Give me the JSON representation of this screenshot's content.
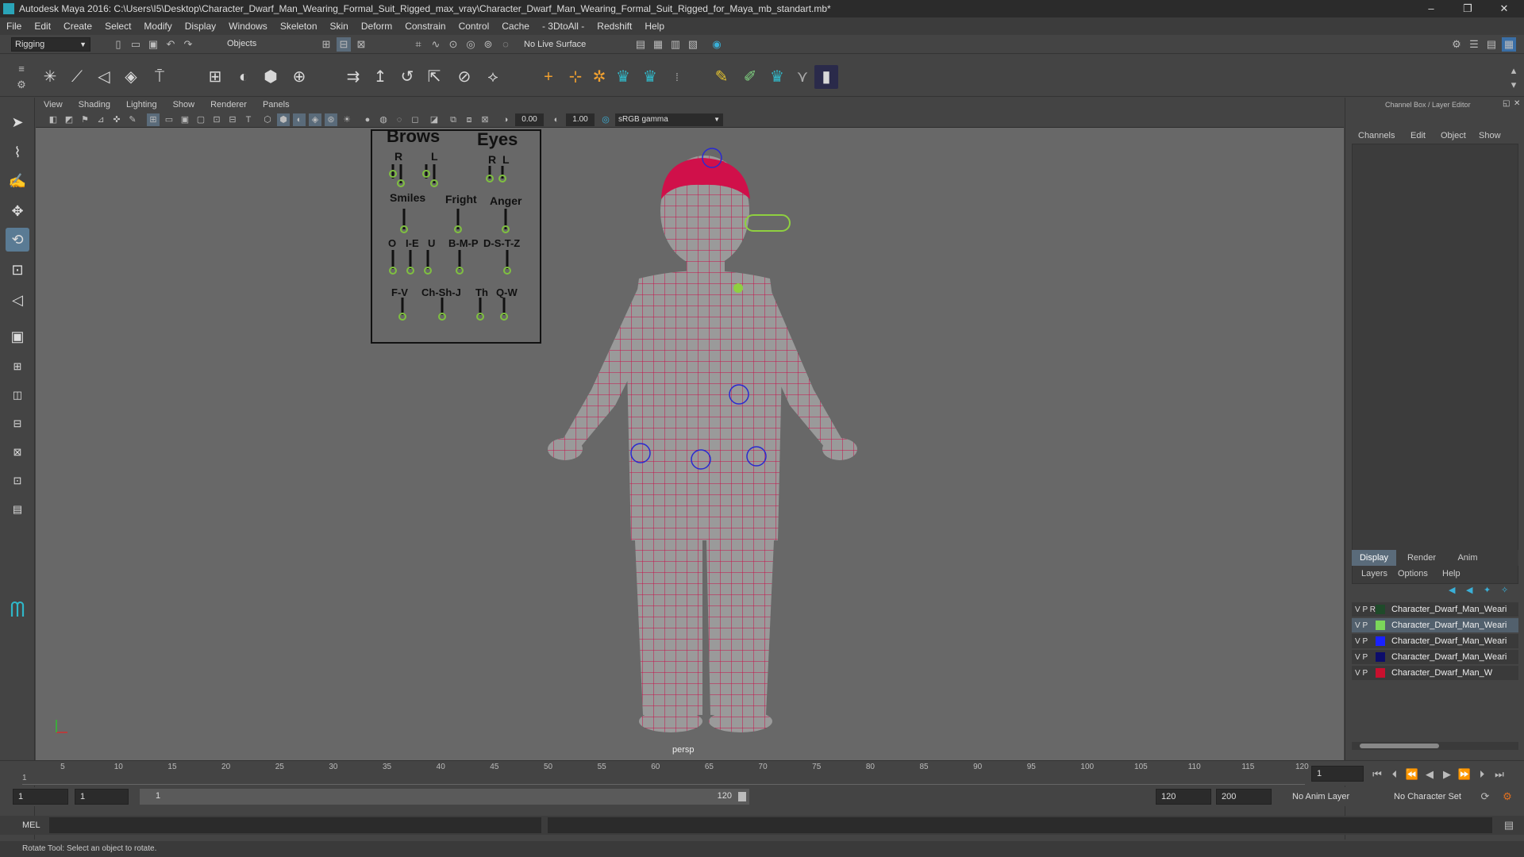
{
  "window": {
    "title": "Autodesk Maya 2016: C:\\Users\\I5\\Desktop\\Character_Dwarf_Man_Wearing_Formal_Suit_Rigged_max_vray\\Character_Dwarf_Man_Wearing_Formal_Suit_Rigged_for_Maya_mb_standart.mb*",
    "minimize": "–",
    "maximize": "❐",
    "close": "✕"
  },
  "menu": [
    "File",
    "Edit",
    "Create",
    "Select",
    "Modify",
    "Display",
    "Windows",
    "Skeleton",
    "Skin",
    "Deform",
    "Constrain",
    "Control",
    "Cache",
    "- 3DtoAll -",
    "Redshift",
    "Help"
  ],
  "status": {
    "menuset": "Rigging",
    "select_mode": "Objects",
    "live_surface": "No Live Surface"
  },
  "panel_menu": [
    "View",
    "Shading",
    "Lighting",
    "Show",
    "Renderer",
    "Panels"
  ],
  "panel_toolbar": {
    "exposure": "0.00",
    "gamma": "1.00",
    "color_space": "sRGB gamma"
  },
  "face_controls": {
    "brows": "Brows",
    "eyes": "Eyes",
    "r1": "R",
    "l1": "L",
    "r2": "R",
    "l2": "L",
    "smiles": "Smiles",
    "fright": "Fright",
    "anger": "Anger",
    "o": "O",
    "ie": "I-E",
    "u": "U",
    "bmp": "B-M-P",
    "dstz": "D-S-T-Z",
    "fv": "F-V",
    "chshj": "Ch-Sh-J",
    "th": "Th",
    "qw": "Q-W"
  },
  "viewport": {
    "camera_label": "persp"
  },
  "channel_box": {
    "title": "Channel Box / Layer Editor",
    "menu": [
      "Channels",
      "Edit",
      "Object",
      "Show"
    ]
  },
  "layer_editor": {
    "tabs": [
      "Display",
      "Render",
      "Anim"
    ],
    "menu": [
      "Layers",
      "Options",
      "Help"
    ],
    "layers": [
      {
        "vis": "V P R",
        "color": "#1f4a2a",
        "name": "Character_Dwarf_Man_Weari",
        "selected": false
      },
      {
        "vis": "V P",
        "color": "#7bd65a",
        "name": "Character_Dwarf_Man_Weari",
        "selected": true
      },
      {
        "vis": "V P",
        "color": "#1a22ff",
        "name": "Character_Dwarf_Man_Weari",
        "selected": false
      },
      {
        "vis": "V P",
        "color": "#0d0d6a",
        "name": "Character_Dwarf_Man_Weari",
        "selected": false
      },
      {
        "vis": "V   P",
        "color": "#c8102e",
        "name": "Character_Dwarf_Man_W",
        "selected": false
      }
    ]
  },
  "time_slider": {
    "ticks": [
      "5",
      "10",
      "15",
      "20",
      "25",
      "30",
      "35",
      "40",
      "45",
      "50",
      "55",
      "60",
      "65",
      "70",
      "75",
      "80",
      "85",
      "90",
      "95",
      "100",
      "105",
      "110",
      "115",
      "120"
    ],
    "first_tick": "1",
    "current_frame": "1"
  },
  "range_slider": {
    "start": "1",
    "anim_start": "1",
    "slider_start": "1",
    "slider_end": "120",
    "range_end": "120",
    "anim_end": "200",
    "anim_layer": "No Anim Layer",
    "character_set": "No Character Set"
  },
  "command_line": {
    "language": "MEL"
  },
  "help_line": "Rotate Tool: Select an object to rotate."
}
